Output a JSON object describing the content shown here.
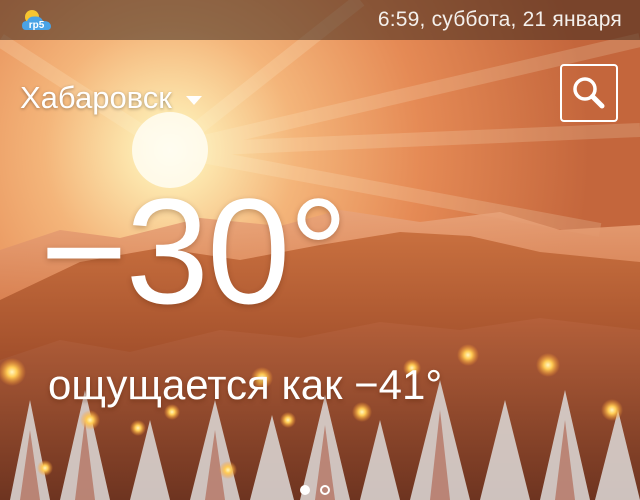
{
  "status_bar": {
    "app_logo_text": "rp5",
    "datetime": "6:59, суббота, 21 января"
  },
  "location": {
    "city": "Хабаровск"
  },
  "weather": {
    "temperature": "−30°",
    "feels_like": "ощущается как −41°"
  },
  "pager": {
    "pages": 2,
    "active_index": 0
  },
  "icons": {
    "logo": "rp5-cloud-sun-logo",
    "dropdown": "triangle-down-icon",
    "search": "magnifier-icon"
  },
  "colors": {
    "sky_bright": "#fff4c8",
    "sky_warm": "#f0a060",
    "mountains": "#d9804a",
    "forest_dark": "#7a3a22",
    "text": "#ffffff"
  }
}
